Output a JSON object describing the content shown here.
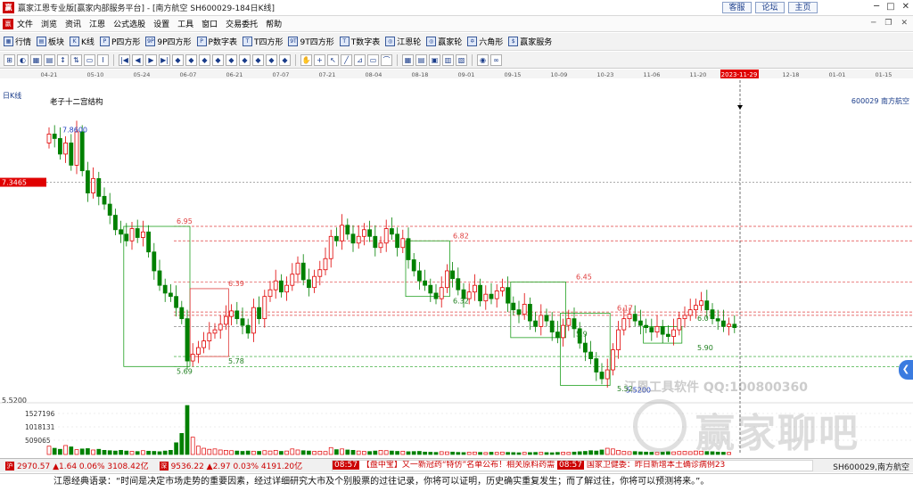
{
  "window": {
    "title": "赢家江恩专业版[赢家内部服务平台] - [南方航空  SH600029-184日K线]",
    "app_icon": "赢",
    "links": [
      "客服",
      "论坛",
      "主页"
    ]
  },
  "menu": {
    "icon": "赢",
    "items": [
      "文件",
      "浏览",
      "资讯",
      "江恩",
      "公式选股",
      "设置",
      "工具",
      "窗口",
      "交易委托",
      "帮助"
    ]
  },
  "toolbar1": {
    "items": [
      {
        "icon": "grid-icon",
        "label": "行情"
      },
      {
        "icon": "block-icon",
        "label": "板块"
      },
      {
        "icon": "kline-icon",
        "label": "K线"
      },
      {
        "icon": "p-square-icon",
        "label": "P四方形"
      },
      {
        "icon": "9p-square-icon",
        "label": "9P四方形"
      },
      {
        "icon": "p-table-icon",
        "label": "P数字表"
      },
      {
        "icon": "t-square-icon",
        "label": "T四方形"
      },
      {
        "icon": "9t-square-icon",
        "label": "9T四方形"
      },
      {
        "icon": "t-table-icon",
        "label": "T数字表"
      },
      {
        "icon": "gann-wheel-icon",
        "label": "江恩轮"
      },
      {
        "icon": "winner-wheel-icon",
        "label": "赢家轮"
      },
      {
        "icon": "hexagon-icon",
        "label": "六角形"
      },
      {
        "icon": "dollar-icon",
        "label": "赢家服务"
      }
    ],
    "glyphs": [
      "▦",
      "▤",
      "K",
      "P",
      "9P",
      "P",
      "T",
      "9T",
      "T",
      "◎",
      "◎",
      "✡",
      "$"
    ]
  },
  "toolbar2": {
    "glyphs": [
      "⊞",
      "◐",
      "▦",
      "▤",
      "↕",
      "⇅",
      "▭",
      "I",
      "|◀",
      "◀",
      "▶",
      "▶|",
      "◆",
      "◆",
      "◆",
      "◆",
      "◆",
      "◆",
      "◆",
      "◆",
      "◆",
      "✋",
      "+",
      "↖",
      "╱",
      "⊿",
      "▭",
      "⌒",
      "▦",
      "▤",
      "▣",
      "▥",
      "▧",
      "◉",
      "∞"
    ]
  },
  "chart": {
    "period_label": "日K线",
    "date_axis": [
      "04-21",
      "05-10",
      "05-24",
      "06-07",
      "06-21",
      "07-07",
      "07-21",
      "08-04",
      "08-18",
      "09-01",
      "09-15",
      "10-09",
      "10-23",
      "11-06",
      "11-20",
      "2023-11-29",
      "12-18",
      "01-01",
      "01-15"
    ],
    "highlight_date": "2023-11-29",
    "stock": "600029  南方航空",
    "structure_label": "老子十二宫结构",
    "price_tag_left": "7.3465",
    "price_low_label": "5.5200",
    "volume_ticks": [
      "1527196",
      "1018131",
      "509065"
    ],
    "colors": {
      "up": "#e00000",
      "down": "#008000",
      "box_green": "#20a020",
      "box_red": "#e04040",
      "cursor": "#e00000"
    }
  },
  "chart_data": {
    "type": "candlestick",
    "price_range": [
      5.38,
      8.12
    ],
    "cursor_price": 7.3465,
    "low_price": 5.52,
    "annotations": [
      {
        "label": "7.8600",
        "price": 7.86
      },
      {
        "label": "6.95",
        "price": 6.95
      },
      {
        "label": "6.82",
        "price": 6.82
      },
      {
        "label": "6.45",
        "price": 6.45
      },
      {
        "label": "6.39",
        "price": 6.39
      },
      {
        "label": "6.32",
        "price": 6.32
      },
      {
        "label": "6.17",
        "price": 6.17
      },
      {
        "label": "5.90",
        "price": 5.9
      },
      {
        "label": "5.78",
        "price": 5.78
      },
      {
        "label": "5.69",
        "price": 5.69
      },
      {
        "label": "5.5200",
        "price": 5.52
      }
    ],
    "extra_annotations": [
      {
        "label": "5.52",
        "price": 5.47
      },
      {
        "label": "6.0",
        "price": 6.1
      },
      {
        "label": "5.9",
        "price": 5.96
      }
    ],
    "boxes": [
      {
        "color": "green",
        "start": 14,
        "end": 25,
        "hi": 6.95,
        "lo": 5.69
      },
      {
        "color": "red",
        "start": 26,
        "end": 32,
        "hi": 6.39,
        "lo": 5.78
      },
      {
        "color": "green",
        "start": 65,
        "end": 72,
        "hi": 6.82,
        "lo": 6.32
      },
      {
        "color": "green",
        "start": 84,
        "end": 93,
        "hi": 6.45,
        "lo": 5.95
      },
      {
        "color": "green",
        "start": 93,
        "end": 101,
        "hi": 6.17,
        "lo": 5.52
      },
      {
        "color": "green",
        "start": 108,
        "end": 114,
        "hi": 6.05,
        "lo": 5.9
      }
    ],
    "dashed_levels": [
      {
        "price": 6.95,
        "color": "red"
      },
      {
        "price": 6.82,
        "color": "red"
      },
      {
        "price": 6.45,
        "color": "red"
      },
      {
        "price": 6.18,
        "color": "red"
      },
      {
        "price": 6.15,
        "color": "red"
      },
      {
        "price": 6.05,
        "color": "gray"
      },
      {
        "price": 5.78,
        "color": "green"
      },
      {
        "price": 5.69,
        "color": "green"
      }
    ],
    "closes": [
      7.78,
      7.74,
      7.6,
      7.7,
      7.5,
      7.8,
      7.45,
      7.25,
      7.38,
      7.22,
      7.15,
      7.05,
      6.92,
      6.88,
      6.82,
      6.93,
      6.85,
      6.9,
      6.72,
      6.55,
      6.42,
      6.35,
      6.32,
      6.22,
      6.12,
      5.74,
      5.8,
      5.86,
      5.92,
      5.99,
      6.02,
      6.07,
      6.14,
      6.19,
      6.12,
      6.06,
      5.99,
      6.22,
      6.12,
      6.32,
      6.38,
      6.46,
      6.36,
      6.42,
      6.52,
      6.62,
      6.47,
      6.4,
      6.5,
      6.56,
      6.66,
      6.86,
      6.82,
      6.96,
      6.88,
      6.8,
      6.86,
      6.92,
      6.86,
      6.76,
      6.8,
      6.93,
      6.88,
      6.76,
      6.84,
      6.65,
      6.55,
      6.46,
      6.42,
      6.35,
      6.3,
      6.4,
      6.55,
      6.48,
      6.38,
      6.3,
      6.36,
      6.42,
      6.28,
      6.34,
      6.3,
      6.37,
      6.4,
      6.26,
      6.2,
      6.16,
      6.25,
      6.1,
      6.05,
      6.15,
      6.1,
      6.0,
      5.95,
      6.06,
      6.12,
      6.03,
      5.9,
      5.82,
      5.76,
      5.64,
      5.58,
      5.66,
      5.84,
      6.02,
      6.12,
      6.16,
      6.1,
      6.06,
      6.04,
      6.0,
      6.05,
      5.98,
      5.96,
      6.02,
      6.12,
      6.15,
      6.2,
      6.24,
      6.28,
      6.2,
      6.12,
      6.1,
      6.05,
      6.07,
      6.04
    ],
    "volumes": [
      240000,
      180000,
      150000,
      260000,
      220000,
      140000,
      160000,
      170000,
      130000,
      150000,
      120000,
      110000,
      100000,
      120000,
      100000,
      90000,
      85000,
      110000,
      95000,
      90000,
      80000,
      100000,
      120000,
      340000,
      610000,
      1420000,
      500000,
      240000,
      180000,
      150000,
      160000,
      130000,
      120000,
      110000,
      100000,
      90000,
      100000,
      95000,
      90000,
      110000,
      100000,
      120000,
      90000,
      100000,
      160000,
      130000,
      110000,
      100000,
      90000,
      95000,
      85000,
      200000,
      140000,
      160000,
      130000,
      120000,
      100000,
      90000,
      85000,
      100000,
      120000,
      110000,
      100000,
      90000,
      95000,
      80000,
      85000,
      90000,
      70000,
      65000,
      60000,
      80000,
      75000,
      70000,
      60000,
      55000,
      65000,
      70000,
      60000,
      55000,
      65000,
      60000,
      70000,
      60000,
      55000,
      50000,
      60000,
      55000,
      60000,
      65000,
      55000,
      50000,
      60000,
      65000,
      60000,
      70000,
      80000,
      90000,
      110000,
      100000,
      130000,
      180000,
      160000,
      120000,
      90000,
      80000,
      85000,
      75000,
      70000,
      65000,
      60000,
      70000,
      80000,
      75000,
      85000,
      90000,
      80000,
      100000,
      95000,
      85000,
      80000,
      70000,
      65000,
      60000
    ]
  },
  "watermark": {
    "line1": "江恩工具软件   QQ:100800360",
    "line2": "赢家聊吧"
  },
  "side_button": "❮",
  "status": {
    "sh_index": "2970.57 ▲1.64 0.06% 3108.42亿",
    "sz_index": "9536.22 ▲2.97 0.03% 4191.20亿",
    "sh_badge": "沪",
    "sz_badge": "深",
    "news_time": "08:57",
    "news_text": "【盘中宝】又一新冠药“特仿”名单公布！相关原料药需",
    "news_time2": "08:57",
    "news_text2": "国家卫健委：昨日新增本土确诊病例23",
    "code": "SH600029,南方航空"
  },
  "quote": "江恩经典语录：“时间是决定市场走势的重要因素，经过详细研究大市及个别股票的过往记录，你将可以证明，历史确实重复发生；而了解过往，你将可以预测将来。”。"
}
